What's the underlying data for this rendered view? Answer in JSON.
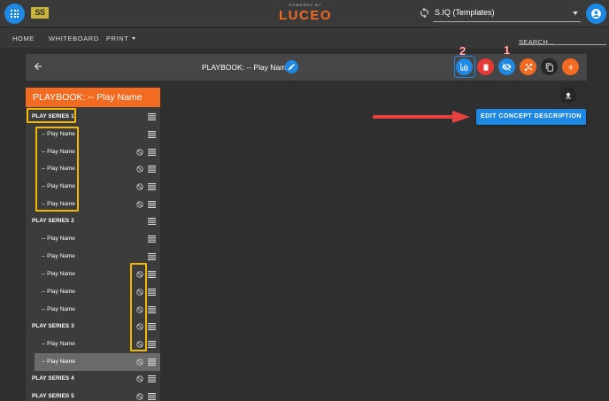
{
  "topbar": {
    "brand_logo_text": "SS",
    "powered_by": "POWERED BY",
    "brand_name": "LUCEO",
    "org_select_value": "S.IQ (Templates)"
  },
  "nav": {
    "home": "HOME",
    "whiteboard": "WHITEBOARD",
    "print": "PRINT"
  },
  "search": {
    "placeholder": "SEARCH..."
  },
  "toolbar": {
    "playbook_title": "PLAYBOOK: -- Play Name",
    "annotation_2": "2",
    "annotation_1": "1"
  },
  "panel": {
    "header": "PLAYBOOK: -- Play Name",
    "rows": [
      {
        "label": "PLAY SERIES 1"
      },
      {
        "label": "-- Play Name"
      },
      {
        "label": "-- Play Name"
      },
      {
        "label": "-- Play Name"
      },
      {
        "label": "-- Play Name"
      },
      {
        "label": "-- Play Name"
      },
      {
        "label": "PLAY SERIES 2"
      },
      {
        "label": "-- Play Name"
      },
      {
        "label": "-- Play Name"
      },
      {
        "label": "-- Play Name"
      },
      {
        "label": "-- Play Name"
      },
      {
        "label": "-- Play Name"
      },
      {
        "label": "PLAY SERIES 3"
      },
      {
        "label": "-- Play Name"
      },
      {
        "label": "-- Play Name"
      },
      {
        "label": "PLAY SERIES 4"
      },
      {
        "label": "PLAY SERIES 5"
      }
    ]
  },
  "main": {
    "edit_concept_label": "EDIT CONCEPT DESCRIPTION"
  },
  "colors": {
    "brand_orange": "#f26b21",
    "accent_blue": "#1e88e5",
    "delete_red": "#e53935",
    "highlight_yellow": "#f5b800",
    "annotation_red": "#e8423f"
  }
}
